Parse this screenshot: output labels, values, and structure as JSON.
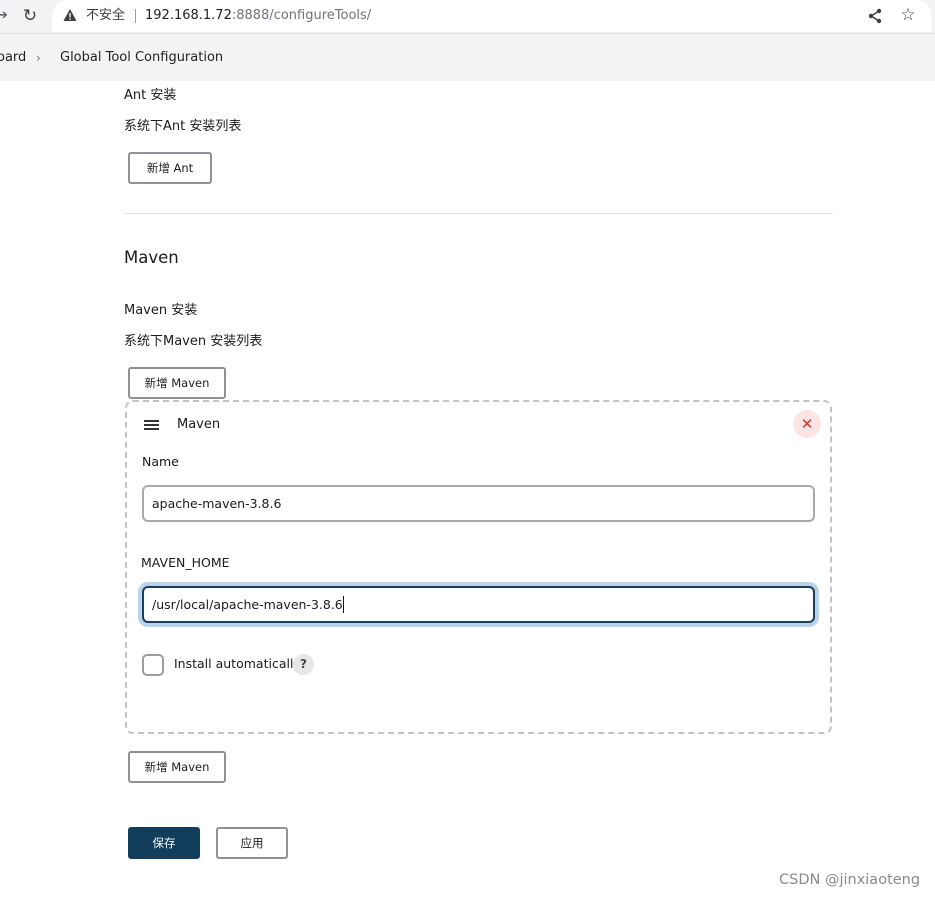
{
  "browser": {
    "security_label": "不安全",
    "url_host": "192.168.1.72",
    "url_rest": ":8888/configureTools/"
  },
  "breadcrumb": {
    "items": [
      "oard",
      "Global Tool Configuration"
    ]
  },
  "ant": {
    "installations_label": "Ant 安装",
    "installations_desc": "系统下Ant 安装列表",
    "add_button": "新增 Ant"
  },
  "maven": {
    "section_title": "Maven",
    "installations_label": "Maven 安装",
    "installations_desc": "系统下Maven 安装列表",
    "add_button_top": "新增 Maven",
    "card": {
      "title": "Maven",
      "name_label": "Name",
      "name_value": "apache-maven-3.8.6",
      "home_label": "MAVEN_HOME",
      "home_value": "/usr/local/apache-maven-3.8.6",
      "install_auto_label": "Install automatically",
      "help_glyph": "?"
    },
    "add_button_bottom": "新增 Maven"
  },
  "actions": {
    "save": "保存",
    "apply": "应用"
  },
  "watermark": "CSDN @jinxiaoteng",
  "colors": {
    "primary": "#123d5b",
    "focus_ring": "#b9d3ea",
    "close_bg": "#fde4e4",
    "close_fg": "#d12f2f"
  },
  "icons": [
    "forward-icon",
    "reload-icon",
    "warning-icon",
    "share-icon",
    "star-icon",
    "chevron-right-icon",
    "drag-handle-icon",
    "close-icon",
    "help-icon"
  ]
}
